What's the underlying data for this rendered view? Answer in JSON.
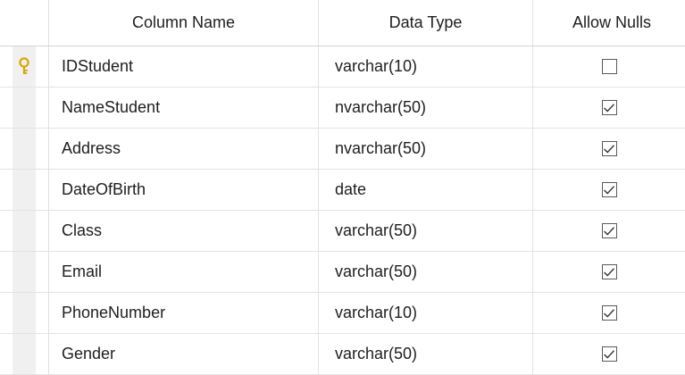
{
  "header": {
    "column_name": "Column Name",
    "data_type": "Data Type",
    "allow_nulls": "Allow Nulls"
  },
  "rows": [
    {
      "name": "IDStudent",
      "type": "varchar(10)",
      "allow_nulls": false,
      "primary_key": true
    },
    {
      "name": "NameStudent",
      "type": "nvarchar(50)",
      "allow_nulls": true,
      "primary_key": false
    },
    {
      "name": "Address",
      "type": "nvarchar(50)",
      "allow_nulls": true,
      "primary_key": false
    },
    {
      "name": "DateOfBirth",
      "type": "date",
      "allow_nulls": true,
      "primary_key": false
    },
    {
      "name": "Class",
      "type": "varchar(50)",
      "allow_nulls": true,
      "primary_key": false
    },
    {
      "name": "Email",
      "type": "varchar(50)",
      "allow_nulls": true,
      "primary_key": false
    },
    {
      "name": "PhoneNumber",
      "type": "varchar(10)",
      "allow_nulls": true,
      "primary_key": false
    },
    {
      "name": "Gender",
      "type": "varchar(50)",
      "allow_nulls": true,
      "primary_key": false
    }
  ],
  "icons": {
    "primary_key": "key-icon",
    "checked": "checkbox-checked-icon"
  },
  "colors": {
    "key_gold": "#d8a800",
    "checkbox_border": "#5a5a5a"
  }
}
